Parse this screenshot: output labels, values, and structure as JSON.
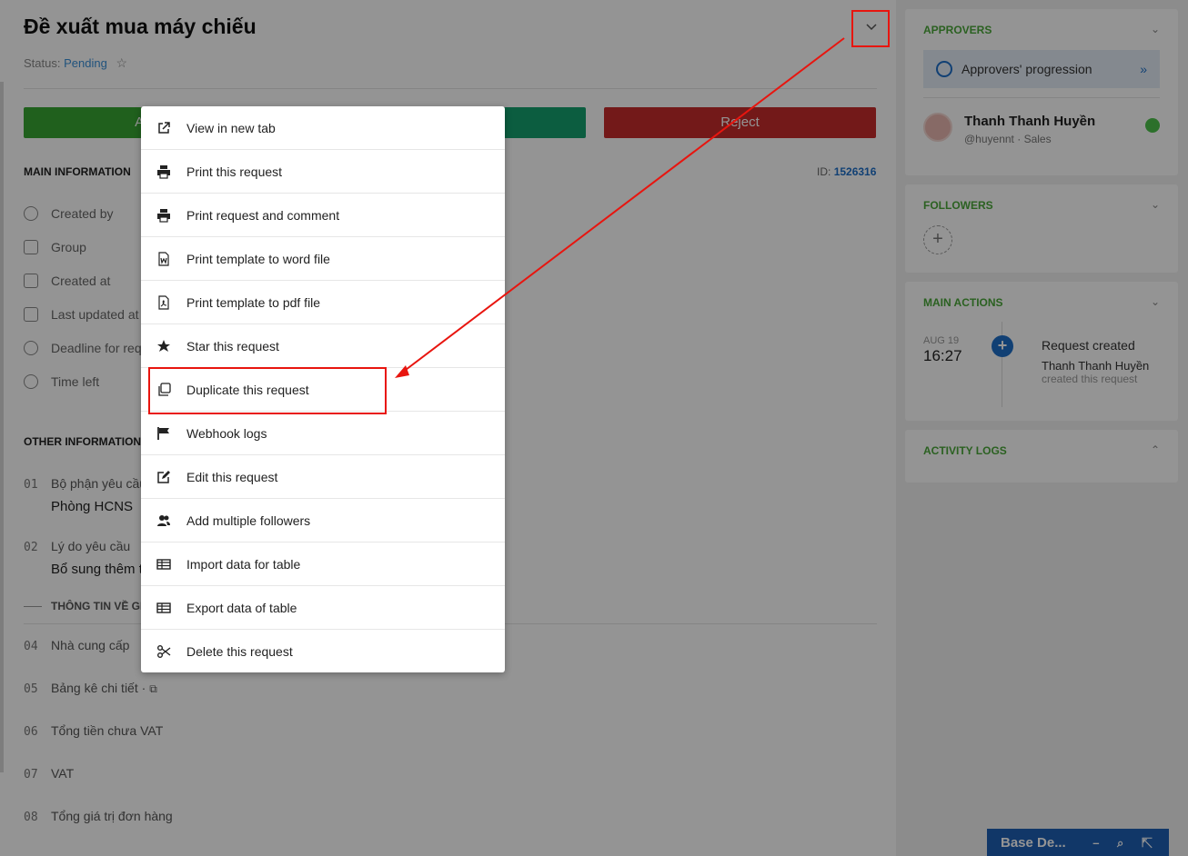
{
  "request": {
    "title": "Đề xuất mua máy chiếu",
    "status_label": "Status:",
    "status_value": "Pending",
    "id_label": "ID:",
    "id_value": "1526316"
  },
  "actions": {
    "approve_label": "Approve",
    "middle_label": "",
    "reject_label": "Reject"
  },
  "main_info": {
    "heading": "MAIN INFORMATION",
    "fields": [
      "Created by",
      "Group",
      "Created at",
      "Last updated at",
      "Deadline for request",
      "Time left"
    ]
  },
  "other_info": {
    "heading": "OTHER INFORMATION",
    "fields": [
      {
        "num": "01",
        "label": "Bộ phận yêu cầu",
        "value": "Phòng HCNS"
      },
      {
        "num": "02",
        "label": "Lý do yêu cầu",
        "value": "Bổ sung thêm t"
      },
      {
        "num": "04",
        "label": "Nhà cung cấp",
        "value": ""
      },
      {
        "num": "05",
        "label": "Bảng kê chi tiết ·",
        "value": ""
      },
      {
        "num": "06",
        "label": "Tổng tiền chưa VAT",
        "value": ""
      },
      {
        "num": "07",
        "label": "VAT",
        "value": ""
      },
      {
        "num": "08",
        "label": "Tổng giá trị đơn hàng",
        "value": ""
      }
    ],
    "group_label": "THÔNG TIN VỀ GIA"
  },
  "menu": {
    "items": [
      {
        "label": "View in new tab",
        "icon": "external-link-icon"
      },
      {
        "label": "Print this request",
        "icon": "printer-icon"
      },
      {
        "label": "Print request and comment",
        "icon": "printer-icon"
      },
      {
        "label": "Print template to word file",
        "icon": "word-file-icon"
      },
      {
        "label": "Print template to pdf file",
        "icon": "pdf-file-icon"
      },
      {
        "label": "Star this request",
        "icon": "star-icon"
      },
      {
        "label": "Duplicate this request",
        "icon": "duplicate-icon"
      },
      {
        "label": "Webhook logs",
        "icon": "flag-icon"
      },
      {
        "label": "Edit this request",
        "icon": "edit-icon"
      },
      {
        "label": "Add multiple followers",
        "icon": "users-icon"
      },
      {
        "label": "Import data for table",
        "icon": "table-icon"
      },
      {
        "label": "Export data of table",
        "icon": "table-icon"
      },
      {
        "label": "Delete this request",
        "icon": "scissors-icon"
      }
    ]
  },
  "sidebar": {
    "approvers": {
      "heading": "APPROVERS",
      "progression_label": "Approvers' progression",
      "approver_name": "Thanh Thanh Huyền",
      "approver_handle": "@huyennt",
      "approver_dept": "Sales"
    },
    "followers": {
      "heading": "FOLLOWERS"
    },
    "main_actions": {
      "heading": "MAIN ACTIONS",
      "date": "AUG 19",
      "time": "16:27",
      "event": "Request created",
      "actor": "Thanh Thanh Huyền",
      "action": "created this request"
    },
    "activity_logs": {
      "heading": "ACTIVITY LOGS"
    }
  },
  "base_bar": {
    "label": "Base De..."
  },
  "colors": {
    "accent_green": "#4aa83a",
    "approve": "#38a532",
    "reject": "#c62b2b",
    "link_blue": "#1e6fc8",
    "annotation_red": "#e8150f"
  }
}
